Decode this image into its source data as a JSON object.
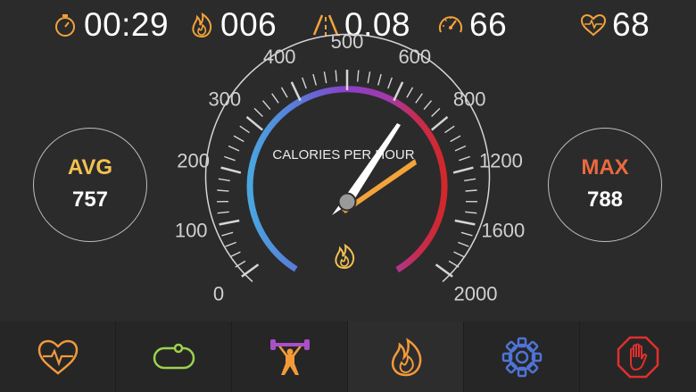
{
  "stats": {
    "time": "00:29",
    "calories": "006",
    "distance": "0.08",
    "speed": "66",
    "heart_rate": "68"
  },
  "gauge": {
    "label": "CALORIES PER HOUR",
    "ticks": [
      "0",
      "100",
      "200",
      "300",
      "400",
      "500",
      "600",
      "800",
      "1200",
      "1600",
      "2000"
    ],
    "needle_value": 757,
    "max_value": 788
  },
  "avg": {
    "label": "AVG",
    "value": "757"
  },
  "max": {
    "label": "MAX",
    "value": "788"
  },
  "nav": [
    {
      "icon": "heart-rate-icon",
      "color": "#ee9a3b"
    },
    {
      "icon": "track-icon",
      "color": "#9ed14e"
    },
    {
      "icon": "weightlifter-icon",
      "color": "#f39a38"
    },
    {
      "icon": "flame-icon",
      "color": "#f39a38"
    },
    {
      "icon": "gear-icon",
      "color": "#4f74d6"
    },
    {
      "icon": "stop-hand-icon",
      "color": "#e0302c"
    }
  ],
  "colors": {
    "accent_orange": "#f3a33a",
    "avg_yellow": "#f3c24f",
    "max_orange": "#ea6a3e",
    "gauge_blue": "#4aa6e0",
    "gauge_purple": "#8a3fc7",
    "gauge_red": "#d2282a"
  }
}
